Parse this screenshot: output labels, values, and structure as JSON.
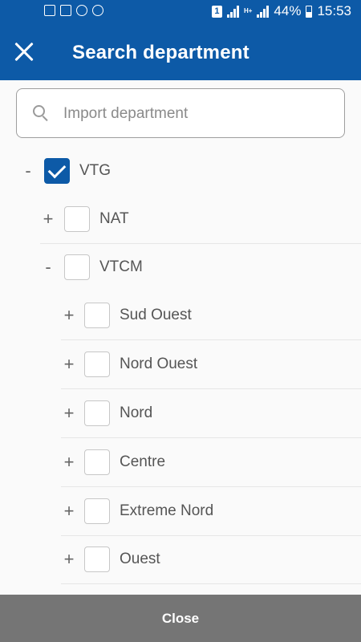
{
  "status_bar": {
    "battery": "44%",
    "time": "15:53",
    "sim": "1",
    "network": "H+"
  },
  "app_bar": {
    "title": "Search department"
  },
  "search": {
    "placeholder": "Import department",
    "value": ""
  },
  "tree": {
    "root": {
      "toggle": "-",
      "label": "VTG",
      "checked": true
    },
    "level1": [
      {
        "toggle": "+",
        "label": "NAT",
        "checked": false
      },
      {
        "toggle": "-",
        "label": "VTCM",
        "checked": false
      }
    ],
    "vtcm_children": [
      {
        "toggle": "+",
        "label": "Sud Ouest",
        "checked": false
      },
      {
        "toggle": "+",
        "label": "Nord Ouest",
        "checked": false
      },
      {
        "toggle": "+",
        "label": "Nord",
        "checked": false
      },
      {
        "toggle": "+",
        "label": "Centre",
        "checked": false
      },
      {
        "toggle": "+",
        "label": "Extreme Nord",
        "checked": false
      },
      {
        "toggle": "+",
        "label": "Ouest",
        "checked": false
      }
    ]
  },
  "footer": {
    "close_label": "Close"
  },
  "colors": {
    "primary": "#0d5aa7",
    "footer": "#757575"
  }
}
